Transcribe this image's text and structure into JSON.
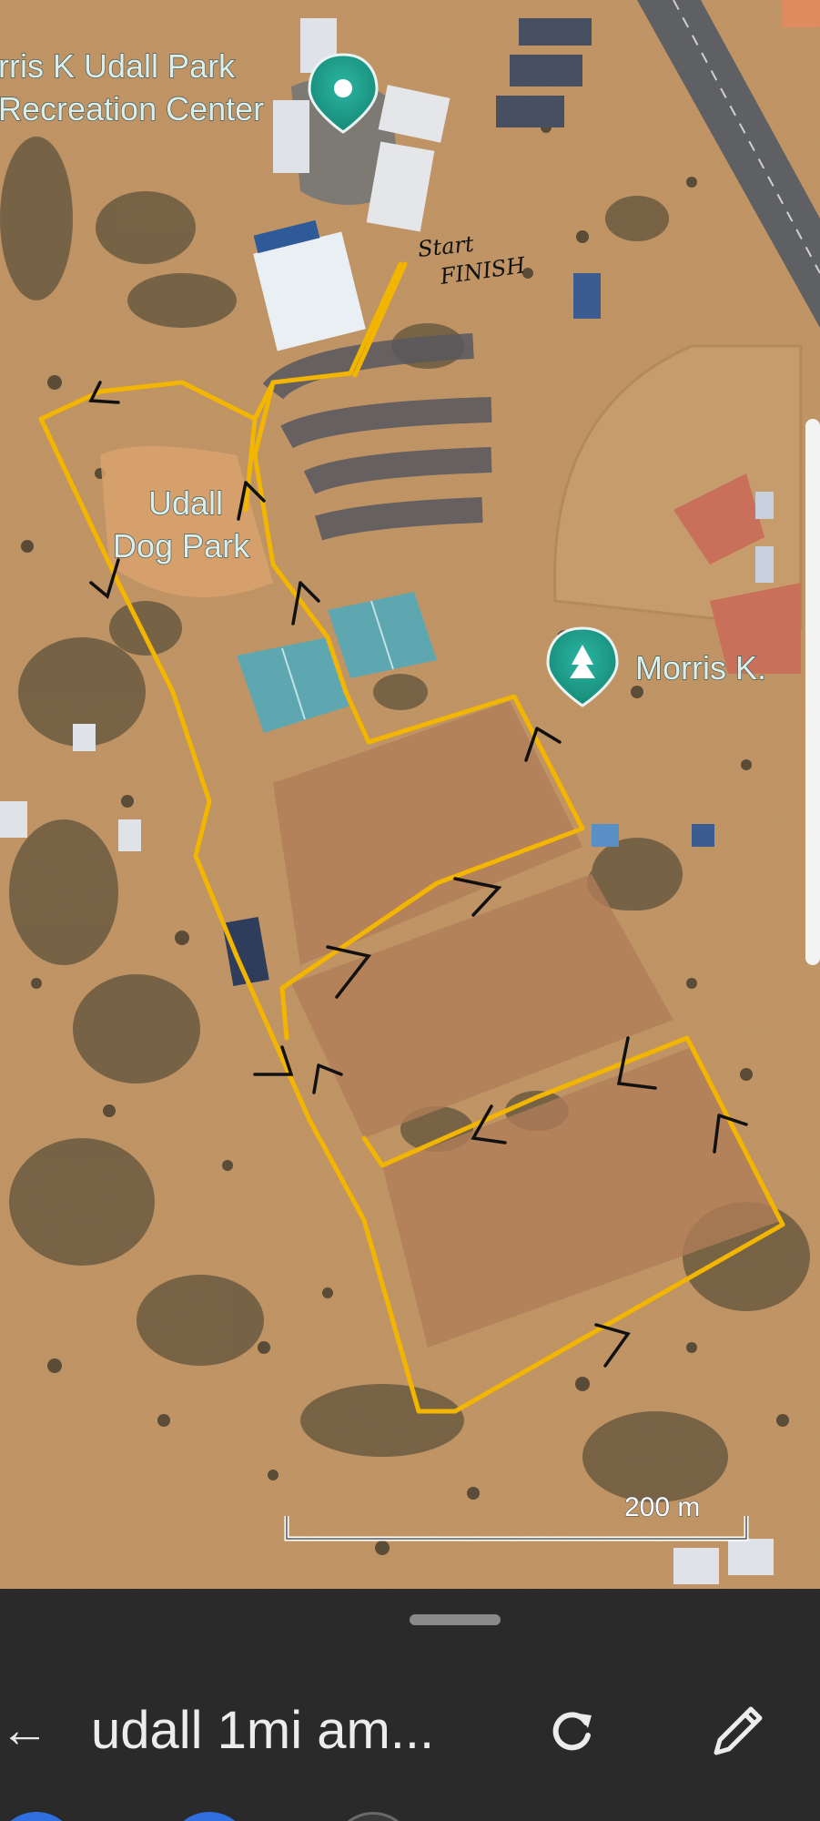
{
  "map": {
    "labels": {
      "recreation_center_line1": "rris K Udall Park",
      "recreation_center_line2": "Recreation Center",
      "dog_park_line1": "Udall",
      "dog_park_line2": "Dog Park",
      "morris_k": "Morris K."
    },
    "handwriting": {
      "start": "Start",
      "finish": "FINISH"
    },
    "scale_label": "200 m",
    "route_color": "#f2b500",
    "pin_color": "#1fa08e"
  },
  "toolbar": {
    "back_icon": "←",
    "title": "udall 1mi am...",
    "refresh_icon": "refresh-icon",
    "edit_icon": "pencil-icon"
  }
}
